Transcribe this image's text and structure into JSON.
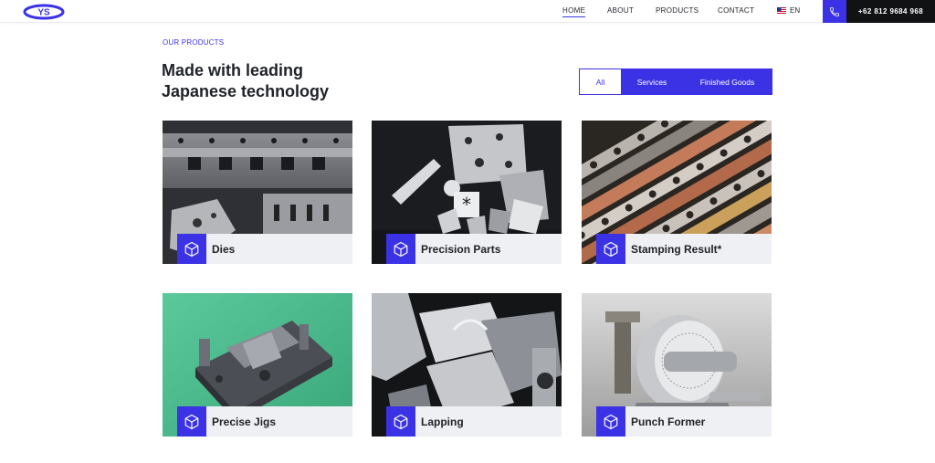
{
  "header": {
    "logo_text": "YS",
    "nav": [
      {
        "label": "HOME",
        "active": true
      },
      {
        "label": "ABOUT",
        "active": false
      },
      {
        "label": "PRODUCTS",
        "active": false
      },
      {
        "label": "CONTACT",
        "active": false
      }
    ],
    "language": "EN",
    "phone": "+62 812 9684 968"
  },
  "section": {
    "eyebrow": "OUR PRODUCTS",
    "headline_line1": "Made with leading",
    "headline_line2": "Japanese technology"
  },
  "filters": [
    {
      "label": "All",
      "selected": true
    },
    {
      "label": "Services",
      "selected": false
    },
    {
      "label": "Finished Goods",
      "selected": false
    }
  ],
  "products": [
    {
      "title": "Dies",
      "icon": "cube-icon",
      "image": "metal die plates"
    },
    {
      "title": "Precision Parts",
      "icon": "cube-icon",
      "image": "machined precision parts"
    },
    {
      "title": "Stamping Result*",
      "icon": "cube-icon",
      "image": "stamped metal strips"
    },
    {
      "title": "Precise Jigs",
      "icon": "cube-icon",
      "image": "jig fixture on green table"
    },
    {
      "title": "Lapping",
      "icon": "cube-icon",
      "image": "lapped steel blocks"
    },
    {
      "title": "Punch Former",
      "icon": "cube-icon",
      "image": "punch former tool"
    }
  ],
  "colors": {
    "accent": "#3b32e6",
    "dark": "#111214",
    "caption_bg": "#eef0f3",
    "text": "#1f2228"
  }
}
